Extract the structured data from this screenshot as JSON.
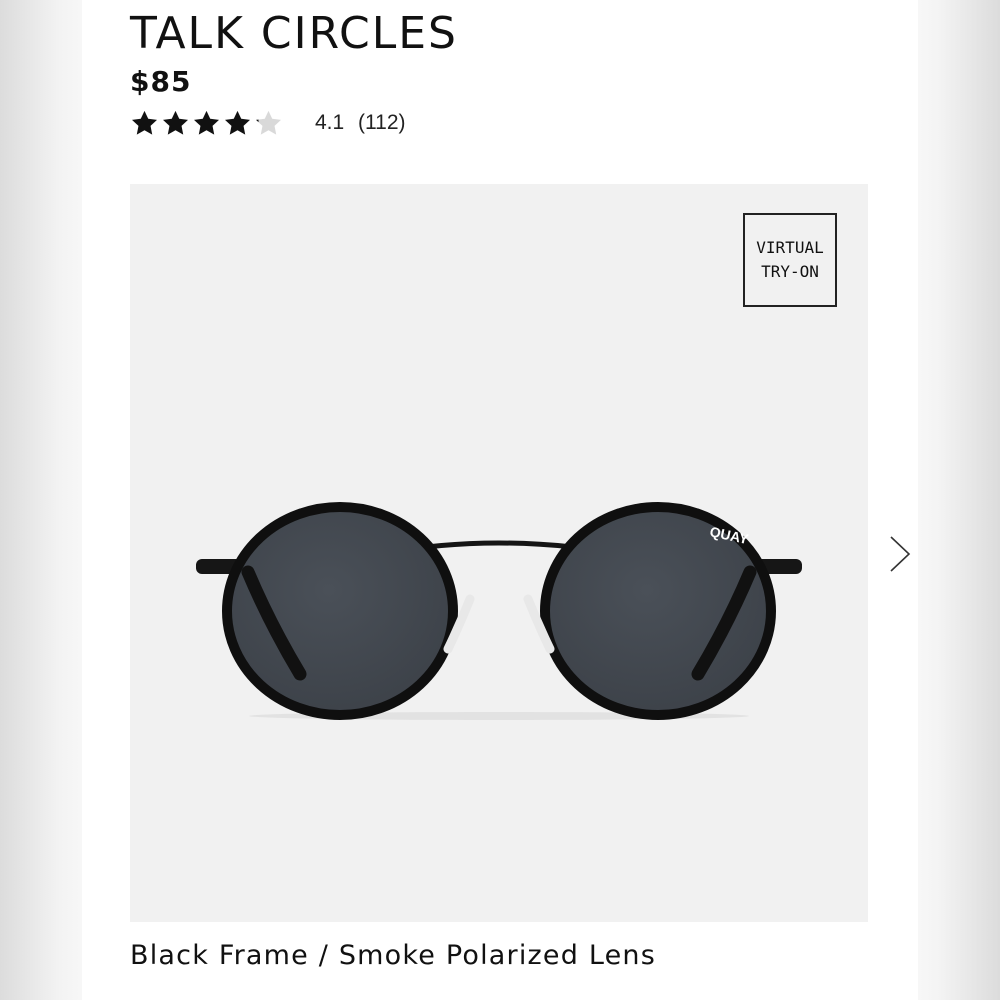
{
  "product": {
    "title": "TALK CIRCLES",
    "price": "$85",
    "rating": {
      "stars_filled": 4.1,
      "stars_total": 5,
      "value": "4.1",
      "count": "(112)"
    },
    "variant": "Black Frame / Smoke Polarized Lens"
  },
  "image": {
    "brand_logo": "QUAY",
    "virtual_tryon": {
      "line1": "VIRTUAL",
      "line2": "TRY-ON"
    }
  },
  "icons": {
    "star": "star-icon",
    "next": "chevron-right-icon"
  },
  "colors": {
    "star_filled": "#111111",
    "star_empty": "#d9d9d9",
    "image_bg": "#f1f1f1"
  }
}
